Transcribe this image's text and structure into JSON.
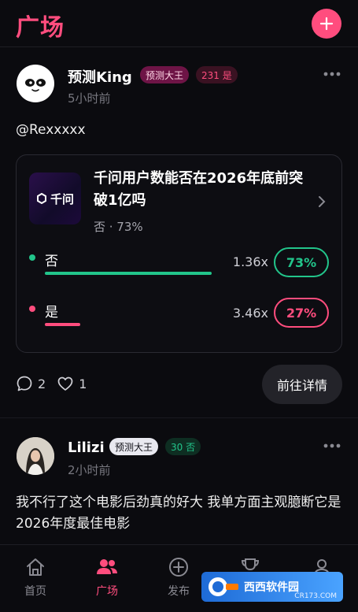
{
  "header": {
    "title": "广场"
  },
  "post1": {
    "author": "预测King",
    "badge": "预测大王",
    "stat_badge": "231 是",
    "time": "5小时前",
    "text": "@Rexxxxx",
    "poll": {
      "thumb_label": "千问",
      "question": "千问用户数能否在2026年底前突破1亿吗",
      "summary": "否 · 73%",
      "options": [
        {
          "label": "否",
          "multiplier": "1.36x",
          "percent": "73%",
          "percent_value": 73,
          "color": "#22c58b"
        },
        {
          "label": "是",
          "multiplier": "3.46x",
          "percent": "27%",
          "percent_value": 27,
          "color": "#ff4d7e"
        }
      ]
    },
    "comments": "2",
    "likes": "1",
    "detail_label": "前往详情"
  },
  "post2": {
    "author": "Lilizi",
    "badge": "预测大王",
    "stat_badge": "30 否",
    "time": "2小时前",
    "text": "我不行了这个电影后劲真的好大 我单方面主观臆断它是2026年度最佳电影"
  },
  "tabs": [
    {
      "label": "首页",
      "icon": "home-icon"
    },
    {
      "label": "广场",
      "icon": "people-icon",
      "active": true
    },
    {
      "label": "发布",
      "icon": "plus-circle-icon"
    },
    {
      "label": "",
      "icon": "trophy-icon"
    },
    {
      "label": "",
      "icon": "user-icon"
    }
  ],
  "watermark": {
    "text": "西西软件园",
    "sub": "CR173.COM"
  },
  "colors": {
    "accent": "#ff4d7e",
    "green": "#22c58b",
    "background": "#0b0b0f"
  }
}
